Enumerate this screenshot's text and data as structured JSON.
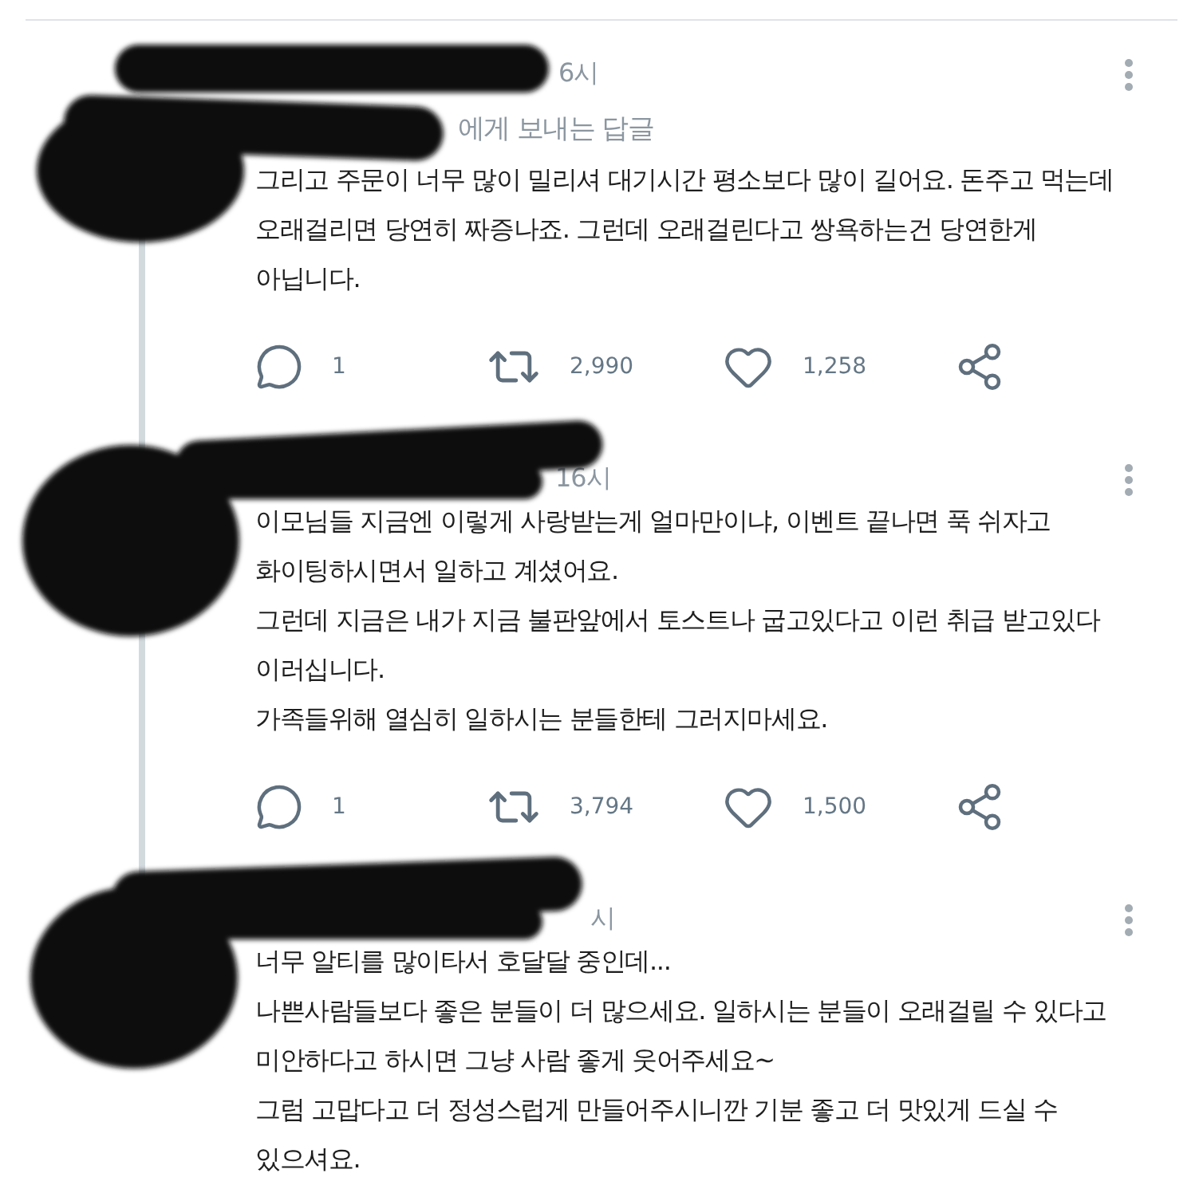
{
  "tweets": [
    {
      "time": "6시",
      "reply_to": "에게 보내는 답글",
      "body": [
        "그리고 주문이 너무 많이 밀리셔 대기시간 평소보다 많이 길어요. 돈주고 먹는데 오래걸리면 당연히 짜증나죠. 그런데 오래걸린다고 쌍욕하는건 당연한게 아닙니다."
      ],
      "stats": {
        "replies": "1",
        "retweets": "2,990",
        "likes": "1,258"
      }
    },
    {
      "time": "16시",
      "body": [
        "이모님들 지금엔 이렇게 사랑받는게 얼마만이냐, 이벤트 끝나면 푹 쉬자고 화이팅하시면서 일하고 계셨어요.",
        "그런데 지금은 내가 지금 불판앞에서 토스트나 굽고있다고 이런 취급 받고있다 이러십니다.",
        "가족들위해 열심히 일하시는 분들한테 그러지마세요."
      ],
      "stats": {
        "replies": "1",
        "retweets": "3,794",
        "likes": "1,500"
      }
    },
    {
      "time": "시",
      "body": [
        "너무 알티를 많이타서 호달달 중인데...",
        "나쁜사람들보다 좋은 분들이 더 많으세요. 일하시는 분들이 오래걸릴 수 있다고 미안하다고 하시면 그냥 사람 좋게 웃어주세요~",
        "그럼 고맙다고 더 정성스럽게 만들어주시니깐 기분 좋고 더 맛있게 드실 수 있으셔요."
      ]
    }
  ]
}
